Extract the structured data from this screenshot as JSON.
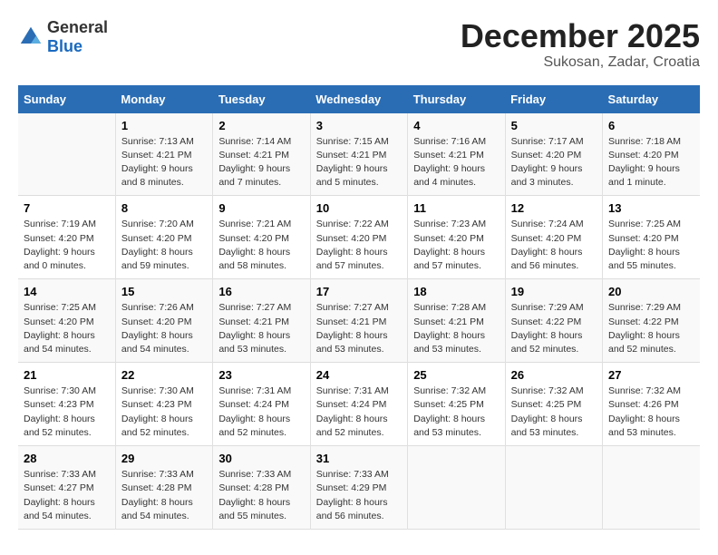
{
  "header": {
    "logo_general": "General",
    "logo_blue": "Blue",
    "month_year": "December 2025",
    "location": "Sukosan, Zadar, Croatia"
  },
  "weekdays": [
    "Sunday",
    "Monday",
    "Tuesday",
    "Wednesday",
    "Thursday",
    "Friday",
    "Saturday"
  ],
  "weeks": [
    [
      {
        "day": "",
        "sunrise": "",
        "sunset": "",
        "daylight": ""
      },
      {
        "day": "1",
        "sunrise": "Sunrise: 7:13 AM",
        "sunset": "Sunset: 4:21 PM",
        "daylight": "Daylight: 9 hours and 8 minutes."
      },
      {
        "day": "2",
        "sunrise": "Sunrise: 7:14 AM",
        "sunset": "Sunset: 4:21 PM",
        "daylight": "Daylight: 9 hours and 7 minutes."
      },
      {
        "day": "3",
        "sunrise": "Sunrise: 7:15 AM",
        "sunset": "Sunset: 4:21 PM",
        "daylight": "Daylight: 9 hours and 5 minutes."
      },
      {
        "day": "4",
        "sunrise": "Sunrise: 7:16 AM",
        "sunset": "Sunset: 4:21 PM",
        "daylight": "Daylight: 9 hours and 4 minutes."
      },
      {
        "day": "5",
        "sunrise": "Sunrise: 7:17 AM",
        "sunset": "Sunset: 4:20 PM",
        "daylight": "Daylight: 9 hours and 3 minutes."
      },
      {
        "day": "6",
        "sunrise": "Sunrise: 7:18 AM",
        "sunset": "Sunset: 4:20 PM",
        "daylight": "Daylight: 9 hours and 1 minute."
      }
    ],
    [
      {
        "day": "7",
        "sunrise": "Sunrise: 7:19 AM",
        "sunset": "Sunset: 4:20 PM",
        "daylight": "Daylight: 9 hours and 0 minutes."
      },
      {
        "day": "8",
        "sunrise": "Sunrise: 7:20 AM",
        "sunset": "Sunset: 4:20 PM",
        "daylight": "Daylight: 8 hours and 59 minutes."
      },
      {
        "day": "9",
        "sunrise": "Sunrise: 7:21 AM",
        "sunset": "Sunset: 4:20 PM",
        "daylight": "Daylight: 8 hours and 58 minutes."
      },
      {
        "day": "10",
        "sunrise": "Sunrise: 7:22 AM",
        "sunset": "Sunset: 4:20 PM",
        "daylight": "Daylight: 8 hours and 57 minutes."
      },
      {
        "day": "11",
        "sunrise": "Sunrise: 7:23 AM",
        "sunset": "Sunset: 4:20 PM",
        "daylight": "Daylight: 8 hours and 57 minutes."
      },
      {
        "day": "12",
        "sunrise": "Sunrise: 7:24 AM",
        "sunset": "Sunset: 4:20 PM",
        "daylight": "Daylight: 8 hours and 56 minutes."
      },
      {
        "day": "13",
        "sunrise": "Sunrise: 7:25 AM",
        "sunset": "Sunset: 4:20 PM",
        "daylight": "Daylight: 8 hours and 55 minutes."
      }
    ],
    [
      {
        "day": "14",
        "sunrise": "Sunrise: 7:25 AM",
        "sunset": "Sunset: 4:20 PM",
        "daylight": "Daylight: 8 hours and 54 minutes."
      },
      {
        "day": "15",
        "sunrise": "Sunrise: 7:26 AM",
        "sunset": "Sunset: 4:20 PM",
        "daylight": "Daylight: 8 hours and 54 minutes."
      },
      {
        "day": "16",
        "sunrise": "Sunrise: 7:27 AM",
        "sunset": "Sunset: 4:21 PM",
        "daylight": "Daylight: 8 hours and 53 minutes."
      },
      {
        "day": "17",
        "sunrise": "Sunrise: 7:27 AM",
        "sunset": "Sunset: 4:21 PM",
        "daylight": "Daylight: 8 hours and 53 minutes."
      },
      {
        "day": "18",
        "sunrise": "Sunrise: 7:28 AM",
        "sunset": "Sunset: 4:21 PM",
        "daylight": "Daylight: 8 hours and 53 minutes."
      },
      {
        "day": "19",
        "sunrise": "Sunrise: 7:29 AM",
        "sunset": "Sunset: 4:22 PM",
        "daylight": "Daylight: 8 hours and 52 minutes."
      },
      {
        "day": "20",
        "sunrise": "Sunrise: 7:29 AM",
        "sunset": "Sunset: 4:22 PM",
        "daylight": "Daylight: 8 hours and 52 minutes."
      }
    ],
    [
      {
        "day": "21",
        "sunrise": "Sunrise: 7:30 AM",
        "sunset": "Sunset: 4:23 PM",
        "daylight": "Daylight: 8 hours and 52 minutes."
      },
      {
        "day": "22",
        "sunrise": "Sunrise: 7:30 AM",
        "sunset": "Sunset: 4:23 PM",
        "daylight": "Daylight: 8 hours and 52 minutes."
      },
      {
        "day": "23",
        "sunrise": "Sunrise: 7:31 AM",
        "sunset": "Sunset: 4:24 PM",
        "daylight": "Daylight: 8 hours and 52 minutes."
      },
      {
        "day": "24",
        "sunrise": "Sunrise: 7:31 AM",
        "sunset": "Sunset: 4:24 PM",
        "daylight": "Daylight: 8 hours and 52 minutes."
      },
      {
        "day": "25",
        "sunrise": "Sunrise: 7:32 AM",
        "sunset": "Sunset: 4:25 PM",
        "daylight": "Daylight: 8 hours and 53 minutes."
      },
      {
        "day": "26",
        "sunrise": "Sunrise: 7:32 AM",
        "sunset": "Sunset: 4:25 PM",
        "daylight": "Daylight: 8 hours and 53 minutes."
      },
      {
        "day": "27",
        "sunrise": "Sunrise: 7:32 AM",
        "sunset": "Sunset: 4:26 PM",
        "daylight": "Daylight: 8 hours and 53 minutes."
      }
    ],
    [
      {
        "day": "28",
        "sunrise": "Sunrise: 7:33 AM",
        "sunset": "Sunset: 4:27 PM",
        "daylight": "Daylight: 8 hours and 54 minutes."
      },
      {
        "day": "29",
        "sunrise": "Sunrise: 7:33 AM",
        "sunset": "Sunset: 4:28 PM",
        "daylight": "Daylight: 8 hours and 54 minutes."
      },
      {
        "day": "30",
        "sunrise": "Sunrise: 7:33 AM",
        "sunset": "Sunset: 4:28 PM",
        "daylight": "Daylight: 8 hours and 55 minutes."
      },
      {
        "day": "31",
        "sunrise": "Sunrise: 7:33 AM",
        "sunset": "Sunset: 4:29 PM",
        "daylight": "Daylight: 8 hours and 56 minutes."
      },
      {
        "day": "",
        "sunrise": "",
        "sunset": "",
        "daylight": ""
      },
      {
        "day": "",
        "sunrise": "",
        "sunset": "",
        "daylight": ""
      },
      {
        "day": "",
        "sunrise": "",
        "sunset": "",
        "daylight": ""
      }
    ]
  ]
}
